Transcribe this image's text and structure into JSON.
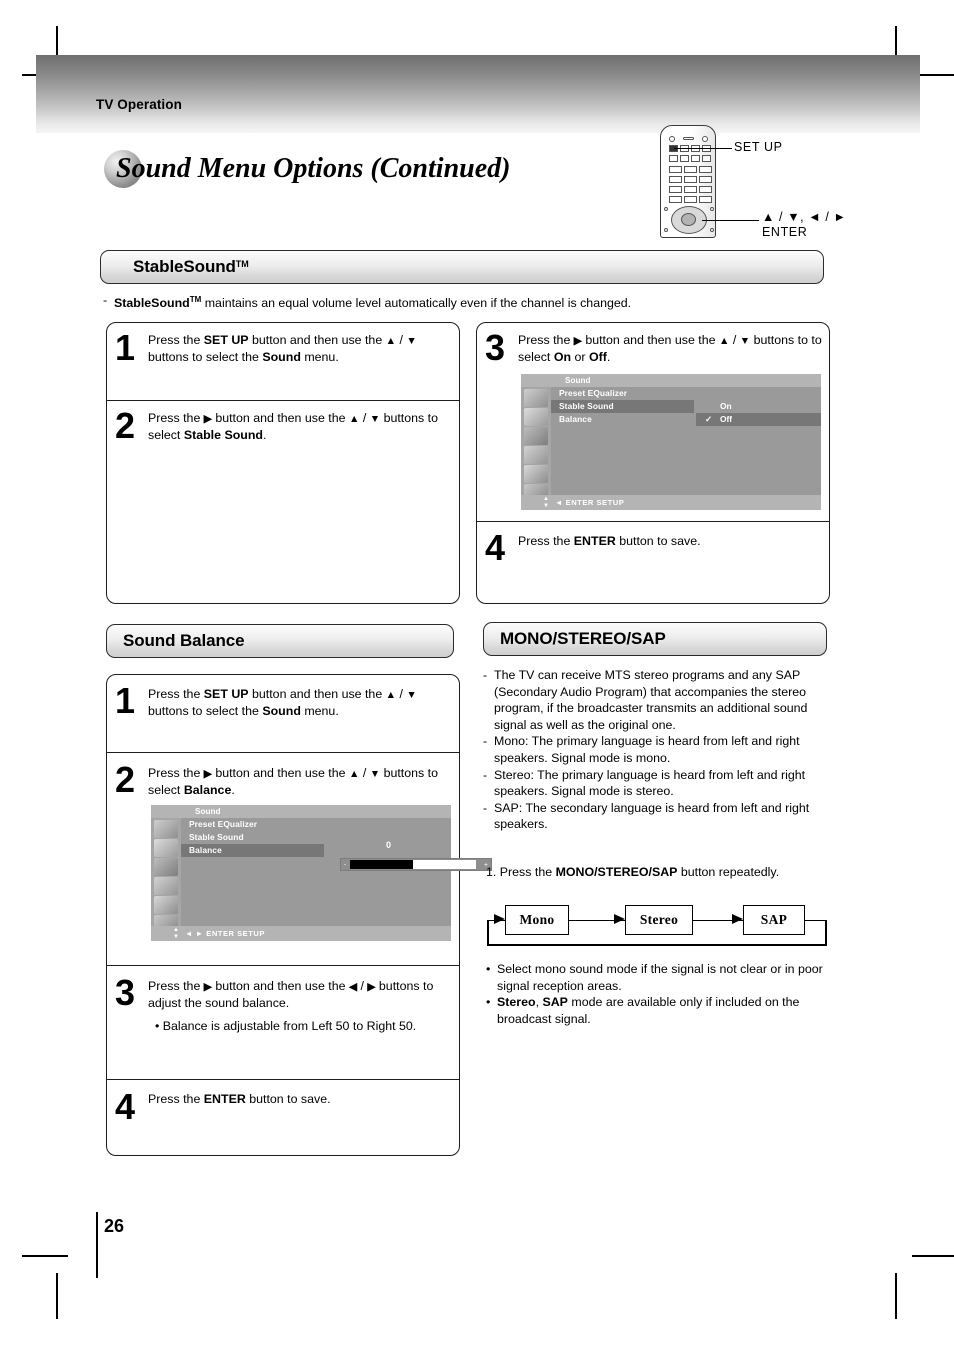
{
  "header": {
    "running_head": "TV Operation",
    "page_title": "Sound Menu Options (Continued)"
  },
  "remote": {
    "label_setup": "SET UP",
    "label_dpad": "▲ / ▼, ◄ / ►",
    "label_enter": "ENTER"
  },
  "stablesound": {
    "heading": "StableSound",
    "heading_tm": "TM",
    "description_prefix": "StableSound",
    "description_tm": "TM",
    "description_rest": " maintains an equal volume level automatically even if the channel is changed.",
    "steps": [
      {
        "num": "1",
        "html": "Press the <b>SET UP</b> button and then use the <b>▲</b> / <b>▼</b> buttons to select the <b>Sound</b> menu."
      },
      {
        "num": "2",
        "html": "Press the <b>►</b> button and then use the <b>▲</b> / <b>▼</b> buttons to select <b>Stable Sound</b>."
      },
      {
        "num": "3",
        "html": "Press the <b>►</b> button and then use the <b>▲</b> / <b>▼</b> buttons to to select <b>On</b> or <b>Off</b>."
      },
      {
        "num": "4",
        "html": "Press the <b>ENTER</b> button to save."
      }
    ]
  },
  "osd_stable": {
    "title": "Sound",
    "menu_items": [
      "Preset EQualizer",
      "Stable Sound",
      "Balance"
    ],
    "highlighted_item": "Stable Sound",
    "options": [
      "On",
      "Off"
    ],
    "checked_option": "Off",
    "check_glyph": "✓",
    "footer": "◄ ENTER  SETUP",
    "icons": [
      "satellite-dish",
      "tv-screen",
      "speaker",
      "disc",
      "remote",
      "monitor"
    ],
    "selected_icon": "speaker"
  },
  "soundbalance": {
    "heading": "Sound Balance",
    "steps": [
      {
        "num": "1",
        "html": "Press the <b>SET UP</b> button and then use the <b>▲</b> / <b>▼</b> buttons to select the <b>Sound</b> menu."
      },
      {
        "num": "2",
        "html": "Press the <b>►</b> button and then use the <b>▲</b> / <b>▼</b> buttons to select <b>Balance</b>."
      },
      {
        "num": "3",
        "html": "Press the <b>►</b> button and then use the <b>◄</b> / <b>►</b> buttons to adjust the sound balance."
      },
      {
        "num": "4",
        "html": "Press the <b>ENTER</b> button to save."
      }
    ],
    "step3_note": "• Balance is adjustable from Left 50 to Right 50."
  },
  "osd_balance": {
    "title": "Sound",
    "menu_items": [
      "Preset EQualizer",
      "Stable Sound",
      "Balance"
    ],
    "highlighted_item": "Balance",
    "value": "0",
    "slider_fill_percent": 50,
    "minus_glyph": "-",
    "plus_glyph": "+",
    "footer": "◄ ► ENTER  SETUP",
    "icons": [
      "satellite-dish",
      "tv-screen",
      "speaker",
      "disc",
      "remote",
      "monitor"
    ],
    "selected_icon": "speaker"
  },
  "monostereosap": {
    "heading": "MONO/STEREO/SAP",
    "bullets": [
      {
        "dash": "-",
        "html": "The TV can receive MTS stereo programs and any SAP (Secondary Audio Program) that accompanies the stereo program, if the broadcaster transmits an additional sound signal as well as the original one."
      },
      {
        "dash": "-",
        "html": "Mono: The primary language is heard from left and right speakers. Signal mode is mono."
      },
      {
        "dash": "-",
        "html": "Stereo: The primary language is heard from left and right speakers. Signal mode is stereo."
      },
      {
        "dash": "-",
        "html": "SAP: The secondary language is heard from left and right speakers."
      }
    ],
    "instruction": "1. Press the <b>MONO/STEREO/SAP</b> button repeatedly.",
    "flow": [
      "Mono",
      "Stereo",
      "SAP"
    ],
    "notes": [
      {
        "dash": "•",
        "html": "Select mono sound mode if the signal is not clear or in poor signal reception areas."
      },
      {
        "dash": "•",
        "html": "<b>Stereo</b>, <b>SAP</b> mode are available only if included on the broadcast signal."
      }
    ]
  },
  "footer": {
    "page_number": "26"
  }
}
